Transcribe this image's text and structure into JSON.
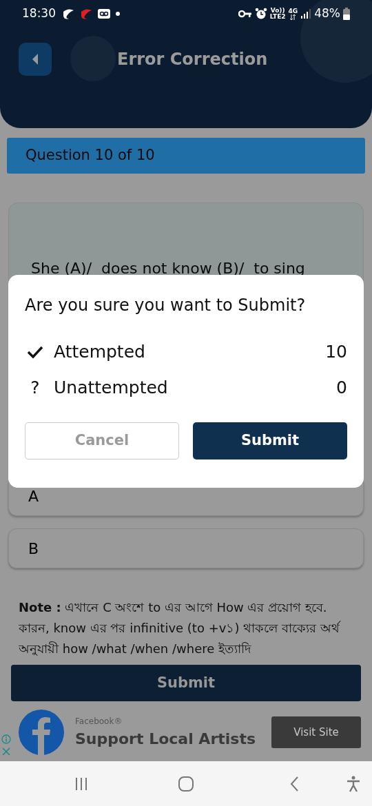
{
  "status_bar": {
    "time": "18:30",
    "volte": "Vo))",
    "lte": "LTE2",
    "network": "4G",
    "battery": "48%"
  },
  "header": {
    "title": "Error Correction"
  },
  "question_bar": {
    "label": "Question 10 of 10"
  },
  "question": {
    "text": "She (A)/  does not know (B)/  to sing"
  },
  "options": [
    {
      "label": "A"
    },
    {
      "label": "B"
    }
  ],
  "note": {
    "text": "**Note :** এখানে C অংশে to এর আগে How এর প্রয়োগ হবে. কারন, know এর পর infinitive (to +v১) থাকলে বাক্যের অর্থ অনুযায়ী how /what /when /where ইত্যাদি"
  },
  "submit_button": {
    "label": "Submit"
  },
  "ad": {
    "advertiser": "Facebook®",
    "headline": "Support Local Artists",
    "cta": "Visit Site"
  },
  "dialog": {
    "title": "Are you sure you want to Submit?",
    "rows": [
      {
        "kind": "attempted",
        "label": "Attempted",
        "count": "10"
      },
      {
        "kind": "unattempted",
        "symbol": "?",
        "label": "Unattempted",
        "count": "0"
      }
    ],
    "buttons": [
      {
        "kind": "cancel",
        "label": "Cancel",
        "disabled": true
      },
      {
        "kind": "submit",
        "label": "Submit",
        "disabled": false
      }
    ]
  }
}
